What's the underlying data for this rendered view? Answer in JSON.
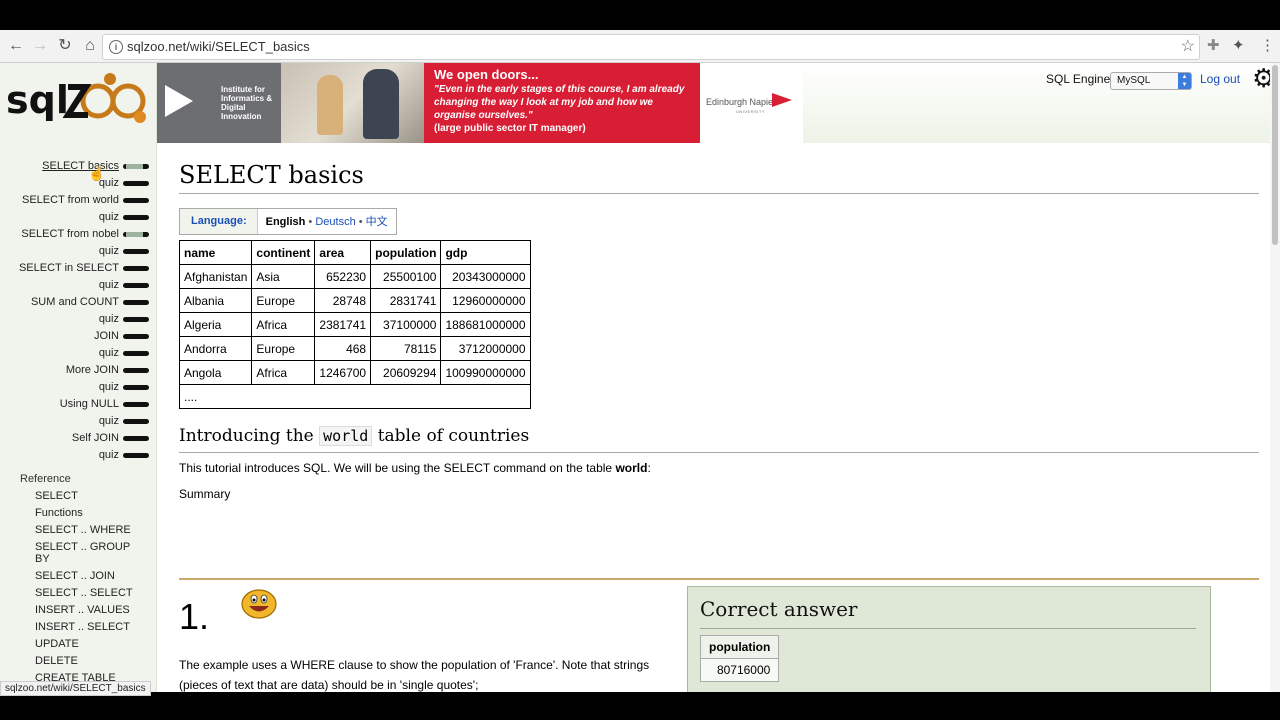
{
  "browser": {
    "url": "sqlzoo.net/wiki/SELECT_basics",
    "status_url": "sqlzoo.net/wiki/SELECT_basics"
  },
  "header": {
    "engine_label": "SQL Engine:",
    "engine_value": "MySQL",
    "logout": "Log out"
  },
  "banner": {
    "institute": "Institute for Informatics & Digital Innovation",
    "headline": "We open doors...",
    "quote": "\"Even in the early stages of this course, I am already changing the way I look at my job and how we organise ourselves.\"",
    "source": "(large public sector IT manager)",
    "university": "Edinburgh Napier",
    "university_sub": "UNIVERSITY"
  },
  "sidebar": {
    "nav": [
      {
        "label": "SELECT basics",
        "progress": 0.15
      },
      {
        "label": "quiz",
        "progress": 1
      },
      {
        "label": "SELECT from world",
        "progress": 1
      },
      {
        "label": "quiz",
        "progress": 1
      },
      {
        "label": "SELECT from nobel",
        "progress": 0.2
      },
      {
        "label": "quiz",
        "progress": 1
      },
      {
        "label": "SELECT in SELECT",
        "progress": 1
      },
      {
        "label": "quiz",
        "progress": 1
      },
      {
        "label": "SUM and COUNT",
        "progress": 1
      },
      {
        "label": "quiz",
        "progress": 1
      },
      {
        "label": "JOIN",
        "progress": 1
      },
      {
        "label": "quiz",
        "progress": 1
      },
      {
        "label": "More JOIN",
        "progress": 1
      },
      {
        "label": "quiz",
        "progress": 1
      },
      {
        "label": "Using NULL",
        "progress": 1
      },
      {
        "label": "quiz",
        "progress": 1
      },
      {
        "label": "Self JOIN",
        "progress": 1
      },
      {
        "label": "quiz",
        "progress": 1
      }
    ],
    "reference_heading": "Reference",
    "reference": [
      "SELECT",
      "Functions",
      "SELECT .. WHERE",
      "SELECT .. GROUP BY",
      "SELECT .. JOIN",
      "SELECT .. SELECT",
      "INSERT .. VALUES",
      "INSERT .. SELECT",
      "UPDATE",
      "DELETE",
      "CREATE TABLE"
    ]
  },
  "main": {
    "title": "SELECT basics",
    "language_label": "Language:",
    "language_current": "English",
    "language_sep": " • ",
    "language_others": [
      "Deutsch",
      "中文"
    ],
    "table": {
      "headers": [
        "name",
        "continent",
        "area",
        "population",
        "gdp"
      ],
      "rows": [
        [
          "Afghanistan",
          "Asia",
          "652230",
          "25500100",
          "20343000000"
        ],
        [
          "Albania",
          "Europe",
          "28748",
          "2831741",
          "12960000000"
        ],
        [
          "Algeria",
          "Africa",
          "2381741",
          "37100000",
          "188681000000"
        ],
        [
          "Andorra",
          "Europe",
          "468",
          "78115",
          "3712000000"
        ],
        [
          "Angola",
          "Africa",
          "1246700",
          "20609294",
          "100990000000"
        ]
      ],
      "ellipsis": "...."
    },
    "section_title_pre": "Introducing the ",
    "section_title_code": "world",
    "section_title_post": " table of countries",
    "intro_text": "This tutorial introduces SQL. We will be using the SELECT command on the table ",
    "intro_bold": "world",
    "intro_end": ":",
    "summary": "Summary",
    "question_number": "1.",
    "question_text": "The example uses a WHERE clause to show the population of 'France'. Note that strings (pieces of text that are data) should be in 'single quotes';",
    "answer": {
      "title": "Correct answer",
      "header": "population",
      "value": "80716000"
    }
  },
  "colors": {
    "sidebar_bg": "#f0f4ec",
    "banner_red": "#d71e35",
    "link_blue": "#1a4fb5",
    "answer_bg": "#dfe8d6"
  }
}
